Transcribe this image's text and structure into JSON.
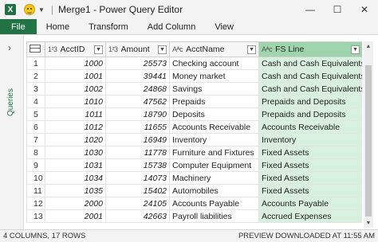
{
  "window": {
    "app_icon": "excel-icon",
    "title": "Merge1 - Power Query Editor",
    "minimize": "—",
    "maximize": "☐",
    "close": "✕"
  },
  "ribbon": {
    "tabs": [
      "File",
      "Home",
      "Transform",
      "Add Column",
      "View"
    ]
  },
  "queries_pane": {
    "label": "Queries",
    "toggle": "›"
  },
  "grid": {
    "columns": [
      {
        "type": "1²3",
        "name": "AcctID"
      },
      {
        "type": "1²3",
        "name": "Amount"
      },
      {
        "type": "Aᴬᴄ",
        "name": "AcctName"
      },
      {
        "type": "Aᴬᴄ",
        "name": "FS Line"
      }
    ],
    "selected_column": "FS Line",
    "rows": [
      [
        "1",
        "1000",
        "25573",
        "Checking account",
        "Cash and Cash Equivalents"
      ],
      [
        "2",
        "1001",
        "39441",
        "Money market",
        "Cash and Cash Equivalents"
      ],
      [
        "3",
        "1002",
        "24868",
        "Savings",
        "Cash and Cash Equivalents"
      ],
      [
        "4",
        "1010",
        "47562",
        "Prepaids",
        "Prepaids and Deposits"
      ],
      [
        "5",
        "1011",
        "18790",
        "Deposits",
        "Prepaids and Deposits"
      ],
      [
        "6",
        "1012",
        "11655",
        "Accounts Receivable",
        "Accounts Receivable"
      ],
      [
        "7",
        "1020",
        "16949",
        "Inventory",
        "Inventory"
      ],
      [
        "8",
        "1030",
        "11778",
        "Furniture and Fixtures",
        "Fixed Assets"
      ],
      [
        "9",
        "1031",
        "15738",
        "Computer Equipment",
        "Fixed Assets"
      ],
      [
        "10",
        "1034",
        "14073",
        "Machinery",
        "Fixed Assets"
      ],
      [
        "11",
        "1035",
        "15402",
        "Automobiles",
        "Fixed Assets"
      ],
      [
        "12",
        "2000",
        "24105",
        "Accounts Payable",
        "Accounts Payable"
      ],
      [
        "13",
        "2001",
        "42663",
        "Payroll liabilities",
        "Accrued Expenses"
      ]
    ]
  },
  "status": {
    "left": "4 COLUMNS, 17 ROWS",
    "right": "PREVIEW DOWNLOADED AT 11:55 AM"
  }
}
